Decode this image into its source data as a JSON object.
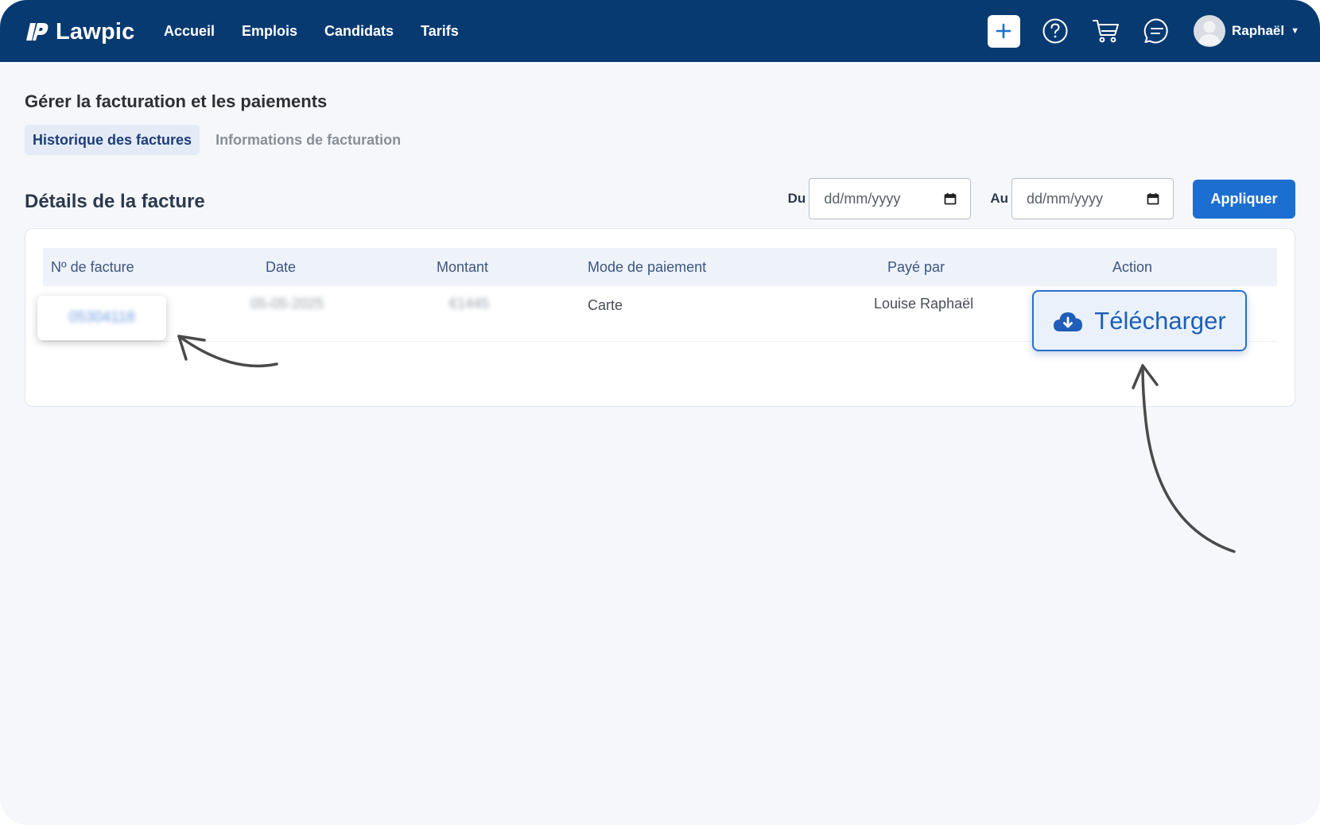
{
  "app": {
    "brand": "Lawpic",
    "nav": [
      {
        "label": "Accueil"
      },
      {
        "label": "Emplois"
      },
      {
        "label": "Candidats"
      },
      {
        "label": "Tarifs"
      }
    ],
    "icons": {
      "add": "plus-icon",
      "help": "help-circle-icon",
      "cart": "cart-icon",
      "messages": "chat-icon",
      "user": "avatar-icon"
    },
    "user_name": "Raphaël",
    "colors": {
      "topbar": "#083a72",
      "accent": "#1c6fd0"
    }
  },
  "page": {
    "title": "Gérer la facturation et les paiements",
    "tabs": [
      {
        "label": "Historique des factures",
        "active": true
      },
      {
        "label": "Informations de facturation",
        "active": false
      }
    ],
    "section_title": "Détails de la facture"
  },
  "filters": {
    "from_label": "Du",
    "from_value": "dd/mm/yyyy",
    "to_label": "Au",
    "to_value": "dd/mm/yyyy",
    "apply_label": "Appliquer"
  },
  "table": {
    "columns": [
      "Nº de facture",
      "Date",
      "Montant",
      "Mode de paiement",
      "Payé par",
      "Action"
    ],
    "rows": [
      {
        "invoice_no": "05304118",
        "date": "05-05-2025",
        "amount": "€1445",
        "payment_mode": "Carte",
        "paid_by": "Louise Raphaël",
        "action_label": "Télécharger"
      }
    ]
  }
}
